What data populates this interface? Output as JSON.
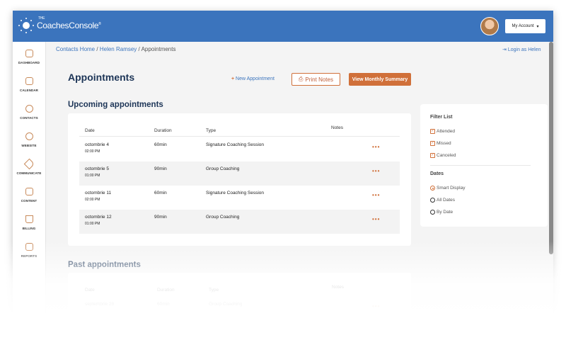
{
  "brand": {
    "small": "THE",
    "name": "CoachesConsole",
    "reg": "®"
  },
  "header": {
    "account_label": "My Account",
    "caret": "▾"
  },
  "sidebar": {
    "items": [
      {
        "label": "DASHBOARD",
        "icon": "home-icon"
      },
      {
        "label": "CALENDAR",
        "icon": "calendar-icon"
      },
      {
        "label": "CONTACTS",
        "icon": "contacts-icon"
      },
      {
        "label": "WEBSITE",
        "icon": "compass-icon"
      },
      {
        "label": "COMMUNICATE",
        "icon": "send-icon"
      },
      {
        "label": "CONTENT",
        "icon": "document-icon"
      },
      {
        "label": "BILLING",
        "icon": "cart-icon"
      },
      {
        "label": "REPORTS",
        "icon": "chart-icon"
      }
    ]
  },
  "breadcrumb": {
    "items": [
      "Contacts Home",
      "Helen Ramsey",
      "Appointments"
    ],
    "sep": "/"
  },
  "login_as": "Login as Helen",
  "page_title": "Appointments",
  "toolbar": {
    "new": "New Appointment",
    "print": "Print Notes",
    "monthly": "View Monthly Summary"
  },
  "upcoming": {
    "title": "Upcoming appointments",
    "columns": [
      "Date",
      "Duration",
      "Type",
      "Notes"
    ],
    "rows": [
      {
        "date": "octombrie 4",
        "time": "02:00 PM",
        "duration": "60min",
        "type": "Signature Coaching Session"
      },
      {
        "date": "octombrie 5",
        "time": "01:00 PM",
        "duration": "90min",
        "type": "Group Coaching"
      },
      {
        "date": "octombrie 11",
        "time": "02:00 PM",
        "duration": "60min",
        "type": "Signature Coaching Session"
      },
      {
        "date": "octombrie 12",
        "time": "01:00 PM",
        "duration": "90min",
        "type": "Group Coaching"
      }
    ]
  },
  "past": {
    "title": "Past appointments",
    "columns": [
      "Date",
      "Duration",
      "Type",
      "Notes"
    ],
    "rows": [
      {
        "date": "septembrie 28",
        "duration": "60min",
        "type": "Group Coaching"
      }
    ]
  },
  "filter": {
    "title": "Filter List",
    "checks": [
      "Attended",
      "Missed",
      "Canceled"
    ],
    "dates_title": "Dates",
    "radios": [
      "Smart Display",
      "All Dates",
      "By Date"
    ],
    "selected": "Smart Display"
  },
  "more": "•••",
  "colors": {
    "header": "#3b74bd",
    "accent": "#d0703a",
    "title": "#1d3557"
  }
}
